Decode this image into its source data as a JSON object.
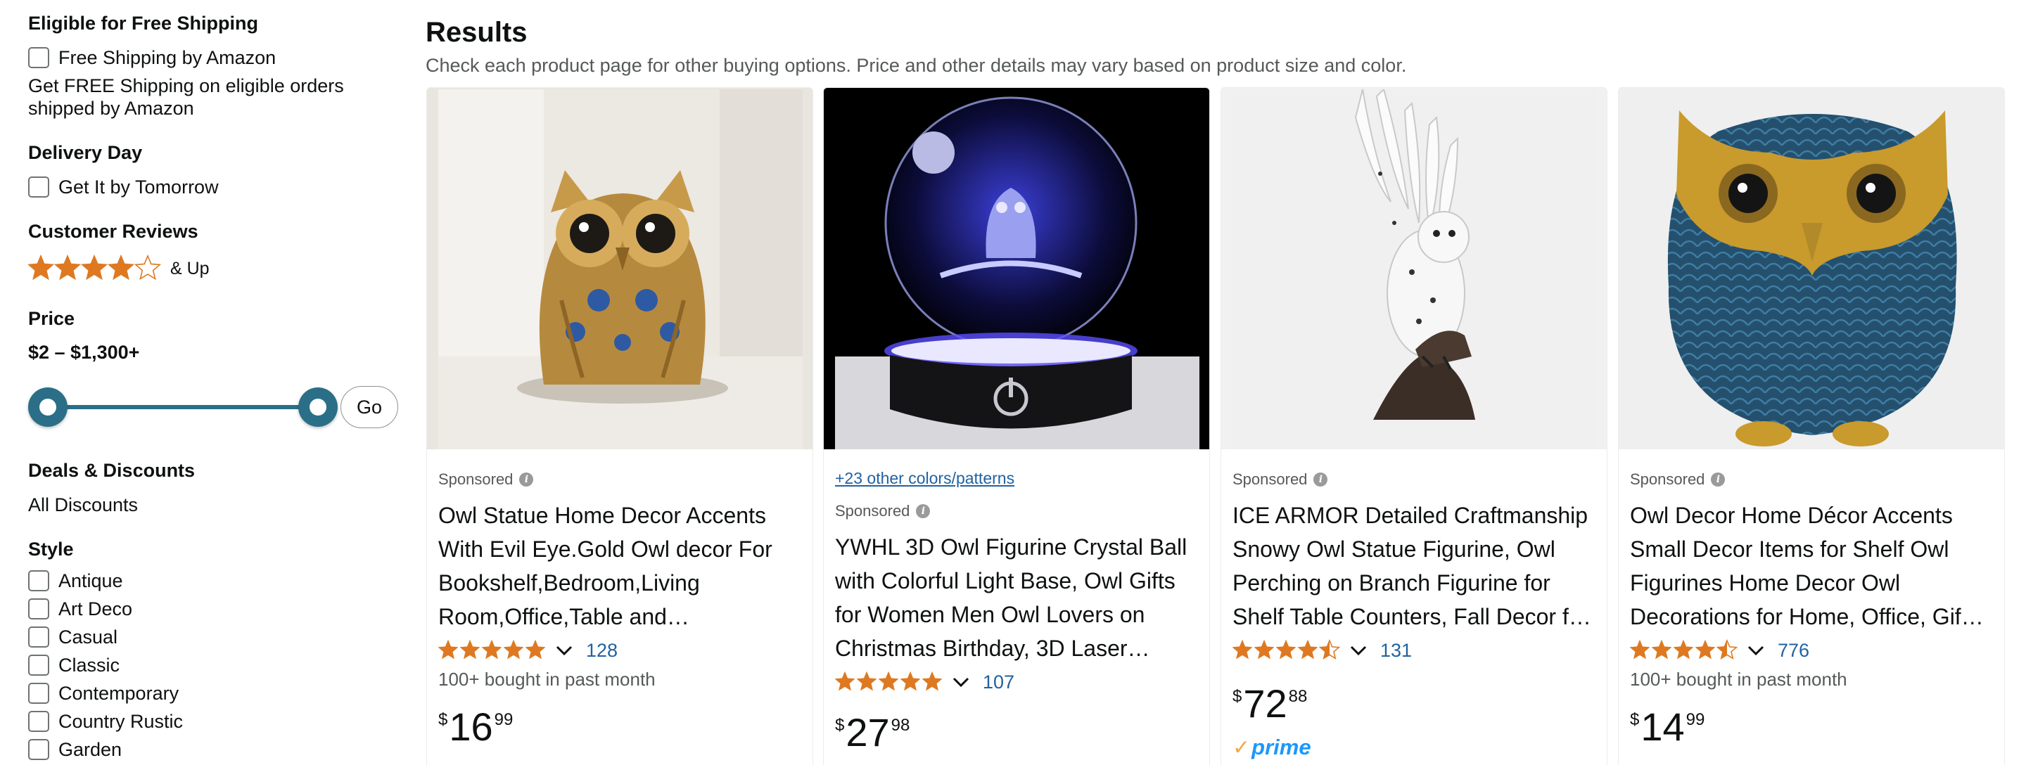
{
  "sidebar": {
    "shipping": {
      "title": "Eligible for Free Shipping",
      "option": "Free Shipping by Amazon",
      "note": "Get FREE Shipping on eligible orders shipped by Amazon"
    },
    "delivery": {
      "title": "Delivery Day",
      "option": "Get It by Tomorrow"
    },
    "reviews": {
      "title": "Customer Reviews",
      "stars_min": 4,
      "suffix": "& Up"
    },
    "price": {
      "title": "Price",
      "range": "$2 – $1,300+",
      "slider_low_fraction": 0,
      "slider_high_fraction": 1,
      "go_label": "Go"
    },
    "deals": {
      "title": "Deals & Discounts",
      "option": "All Discounts"
    },
    "style": {
      "title": "Style",
      "options": [
        "Antique",
        "Art Deco",
        "Casual",
        "Classic",
        "Contemporary",
        "Country Rustic",
        "Garden"
      ]
    }
  },
  "results": {
    "title": "Results",
    "subtitle": "Check each product page for other buying options. Price and other details may vary based on product size and color."
  },
  "products": [
    {
      "image_icon": "golden-owl-statue-image",
      "sponsored": "Sponsored",
      "title": "Owl Statue Home Decor Accents With Evil Eye.Gold Owl decor For Bookshelf,Bedroom,Living Room,Office,Table and…",
      "rating": 5.0,
      "reviews": "128",
      "bought": "100+ bought in past month",
      "price_symbol": "$",
      "price_whole": "16",
      "price_fraction": "99"
    },
    {
      "image_icon": "crystal-ball-owl-image",
      "colors_link": "+23 other colors/patterns",
      "sponsored": "Sponsored",
      "title": "YWHL 3D Owl Figurine Crystal Ball with Colorful Light Base, Owl Gifts for Women Men Owl Lovers on Christmas Birthday, 3D Laser…",
      "rating": 5.0,
      "reviews": "107",
      "price_symbol": "$",
      "price_whole": "27",
      "price_fraction": "98"
    },
    {
      "image_icon": "snowy-owl-figurine-image",
      "sponsored": "Sponsored",
      "title": "ICE ARMOR Detailed Craftmanship Snowy Owl Statue Figurine, Owl Perching on Branch Figurine for Shelf Table Counters, Fall Decor f…",
      "rating": 4.5,
      "reviews": "131",
      "price_symbol": "$",
      "price_whole": "72",
      "price_fraction": "88",
      "prime": "prime"
    },
    {
      "image_icon": "blue-gold-owl-image",
      "sponsored": "Sponsored",
      "title": "Owl Decor Home Décor Accents Small Decor Items for Shelf Owl Figurines Home Decor Owl Decorations for Home, Office, Gif…",
      "rating": 4.5,
      "reviews": "776",
      "bought": "100+ bought in past month",
      "price_symbol": "$",
      "price_whole": "14",
      "price_fraction": "99"
    }
  ],
  "colors": {
    "star": "#de7921",
    "link": "#2162a1",
    "slider": "#2a6f87",
    "prime_blue": "#1a98ff",
    "prime_check": "#f3a847"
  }
}
